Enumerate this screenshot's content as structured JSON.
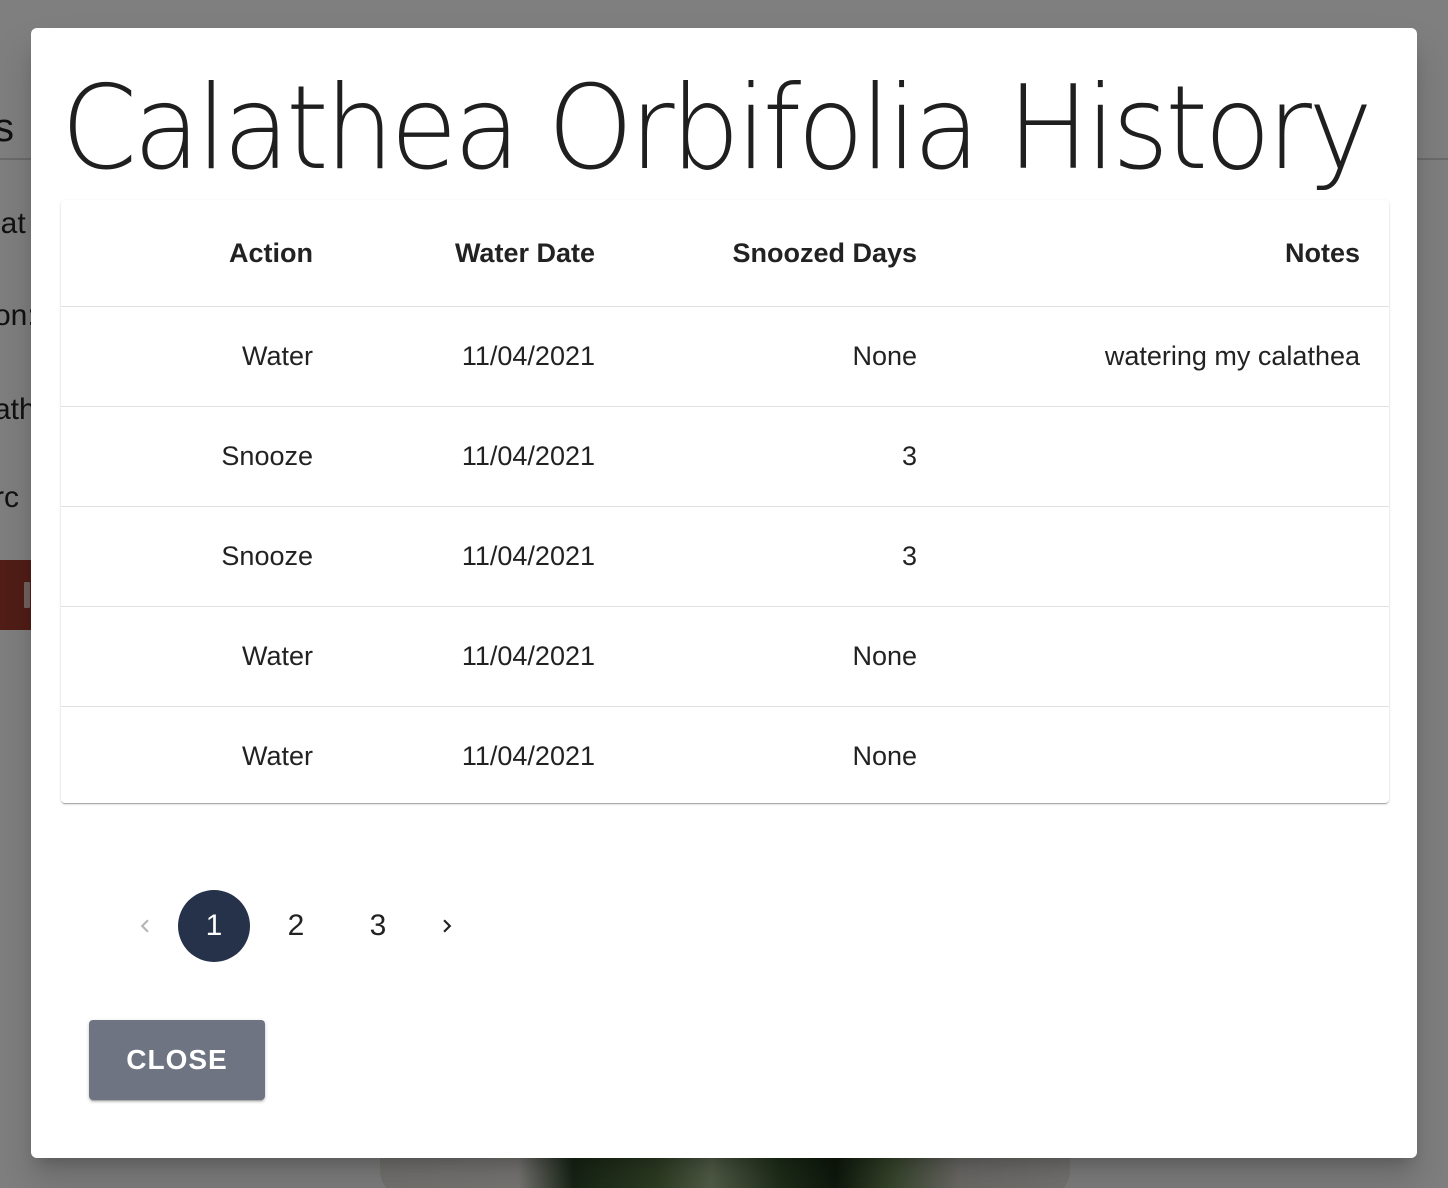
{
  "background": {
    "header_fragment": "s",
    "label_fragments": [
      "lat",
      "on:",
      "ath",
      "rc"
    ]
  },
  "modal": {
    "title": "Calathea Orbifolia History",
    "table": {
      "columns": [
        "Action",
        "Water Date",
        "Snoozed Days",
        "Notes"
      ],
      "rows": [
        {
          "action": "Water",
          "water_date": "11/04/2021",
          "snoozed_days": "None",
          "notes": "watering my calathea"
        },
        {
          "action": "Snooze",
          "water_date": "11/04/2021",
          "snoozed_days": "3",
          "notes": ""
        },
        {
          "action": "Snooze",
          "water_date": "11/04/2021",
          "snoozed_days": "3",
          "notes": ""
        },
        {
          "action": "Water",
          "water_date": "11/04/2021",
          "snoozed_days": "None",
          "notes": ""
        },
        {
          "action": "Water",
          "water_date": "11/04/2021",
          "snoozed_days": "None",
          "notes": ""
        }
      ]
    },
    "pagination": {
      "pages": [
        "1",
        "2",
        "3"
      ],
      "current_page": "1",
      "prev_icon": "chevron-left-icon",
      "next_icon": "chevron-right-icon"
    },
    "close_label": "CLOSE"
  },
  "colors": {
    "active_page": "#25324a",
    "close_button": "#6e7481",
    "background_delete_button": "#a33a2c"
  }
}
